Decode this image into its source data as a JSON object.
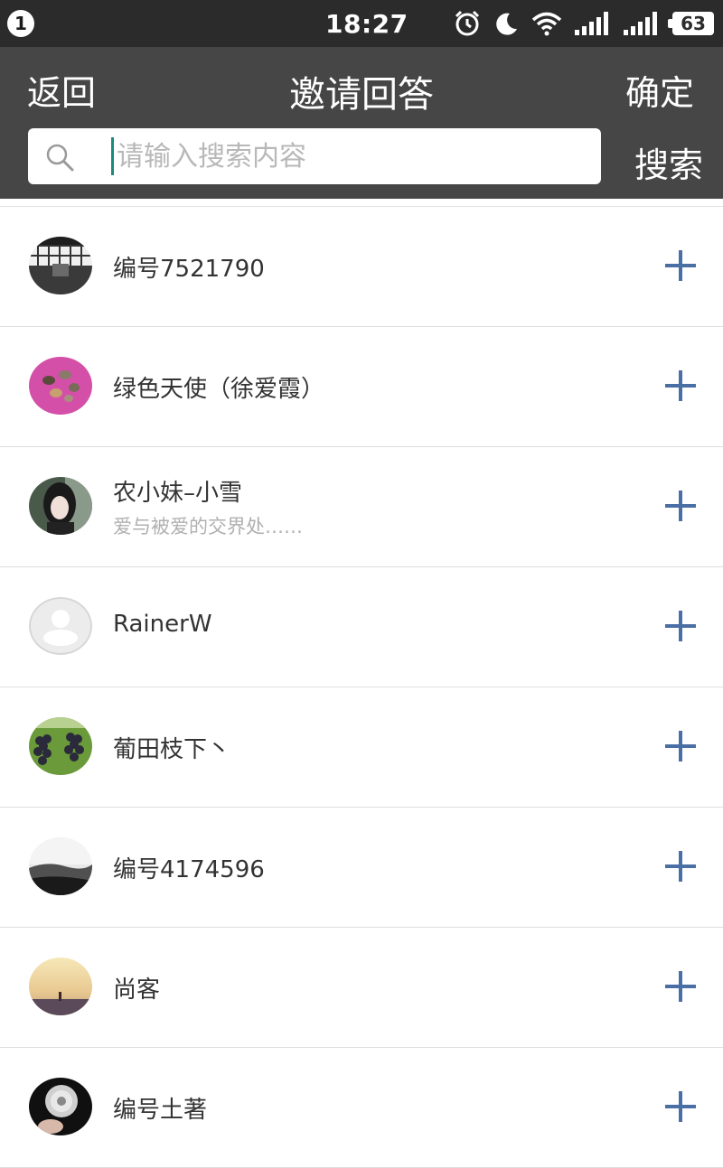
{
  "status_bar": {
    "notification_count": "1",
    "time": "18:27",
    "battery": "63",
    "icons": [
      "alarm-icon",
      "moon-icon",
      "wifi-icon",
      "signal-1-icon",
      "signal-2-icon",
      "battery-icon"
    ]
  },
  "header": {
    "back_label": "返回",
    "title": "邀请回答",
    "confirm_label": "确定",
    "search_placeholder": "请输入搜索内容",
    "search_value": "",
    "search_button_label": "搜索"
  },
  "colors": {
    "header_bg": "#464646",
    "statusbar_bg": "#2b2b2b",
    "accent_plus": "#4a6fa5"
  },
  "users": [
    {
      "name": "编号7521790",
      "subtitle": "",
      "avatar": "bw-interior-photo"
    },
    {
      "name": "绿色天使（徐爱霞）",
      "subtitle": "",
      "avatar": "pink-nuts-photo"
    },
    {
      "name": "农小妹–小雪",
      "subtitle": "爱与被爱的交界处……",
      "avatar": "girl-portrait-photo"
    },
    {
      "name": "RainerW",
      "subtitle": "",
      "avatar": "default-person-avatar"
    },
    {
      "name": "葡田枝下丶",
      "subtitle": "",
      "avatar": "grapes-photo"
    },
    {
      "name": "编号4174596",
      "subtitle": "",
      "avatar": "bw-landscape-photo"
    },
    {
      "name": "尚客",
      "subtitle": "",
      "avatar": "sunset-field-photo"
    },
    {
      "name": "编号土著",
      "subtitle": "",
      "avatar": "dandelion-photo"
    }
  ]
}
